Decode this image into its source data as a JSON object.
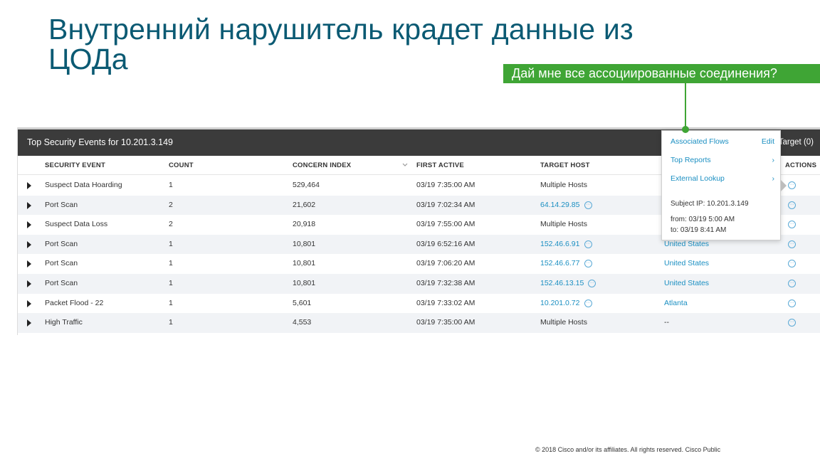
{
  "slide": {
    "title_line1": "Внутренний нарушитель крадет данные из",
    "title_line2": "ЦОДа",
    "callout": "Дай мне все ассоциированные соединения?",
    "footer": "© 2018  Cisco and/or its affiliates. All rights reserved.   Cisco Public",
    "accent_color": "#3fa535",
    "title_color": "#0b5a73"
  },
  "panel": {
    "title": "Top Security Events for 10.201.3.149",
    "target_label": "Target (0)",
    "columns": {
      "security_event": "SECURITY EVENT",
      "count": "COUNT",
      "concern_index": "CONCERN INDEX",
      "first_active": "FIRST ACTIVE",
      "target_host": "TARGET HOST",
      "actions": "ACTIONS"
    },
    "rows": [
      {
        "event": "Suspect Data Hoarding",
        "count": "1",
        "concern": "529,464",
        "first_active": "03/19 7:35:00 AM",
        "target_host": "Multiple Hosts",
        "host_link": false,
        "target": ""
      },
      {
        "event": "Port Scan",
        "count": "2",
        "concern": "21,602",
        "first_active": "03/19 7:02:34 AM",
        "target_host": "64.14.29.85",
        "host_link": true,
        "target": ""
      },
      {
        "event": "Suspect Data Loss",
        "count": "2",
        "concern": "20,918",
        "first_active": "03/19 7:55:00 AM",
        "target_host": "Multiple Hosts",
        "host_link": false,
        "target": ""
      },
      {
        "event": "Port Scan",
        "count": "1",
        "concern": "10,801",
        "first_active": "03/19 6:52:16 AM",
        "target_host": "152.46.6.91",
        "host_link": true,
        "target": "United States"
      },
      {
        "event": "Port Scan",
        "count": "1",
        "concern": "10,801",
        "first_active": "03/19 7:06:20 AM",
        "target_host": "152.46.6.77",
        "host_link": true,
        "target": "United States"
      },
      {
        "event": "Port Scan",
        "count": "1",
        "concern": "10,801",
        "first_active": "03/19 7:32:38 AM",
        "target_host": "152.46.13.15",
        "host_link": true,
        "target": "United States"
      },
      {
        "event": "Packet Flood - 22",
        "count": "1",
        "concern": "5,601",
        "first_active": "03/19 7:33:02 AM",
        "target_host": "10.201.0.72",
        "host_link": true,
        "target": "Atlanta"
      },
      {
        "event": "High Traffic",
        "count": "1",
        "concern": "4,553",
        "first_active": "03/19 7:35:00 AM",
        "target_host": "Multiple Hosts",
        "host_link": false,
        "target": "--"
      }
    ]
  },
  "popup": {
    "associated_flows": "Associated Flows",
    "edit": "Edit",
    "top_reports": "Top Reports",
    "external_lookup": "External Lookup",
    "chevron": "›",
    "subject_ip": "Subject IP: 10.201.3.149",
    "from": "from: 03/19 5:00 AM",
    "to": "to: 03/19 8:41 AM"
  },
  "icons": {
    "more": "···"
  }
}
